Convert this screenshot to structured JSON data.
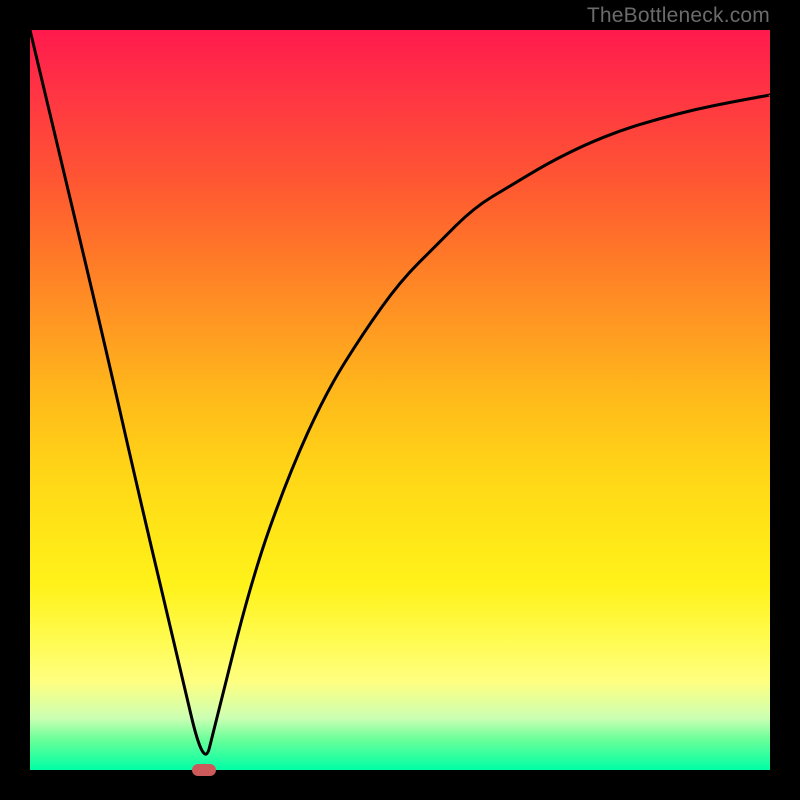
{
  "watermark": "TheBottleneck.com",
  "chart_data": {
    "type": "line",
    "title": "",
    "xlabel": "",
    "ylabel": "",
    "xlim": [
      0,
      100
    ],
    "ylim": [
      0,
      100
    ],
    "grid": false,
    "legend": false,
    "series": [
      {
        "name": "bottleneck-curve",
        "color": "#000000",
        "x": [
          0,
          5,
          10,
          15,
          20,
          23.5,
          25,
          30,
          35,
          40,
          45,
          50,
          55,
          60,
          65,
          70,
          75,
          80,
          85,
          90,
          95,
          100
        ],
        "values": [
          100,
          79,
          58,
          36,
          15,
          0,
          6,
          26,
          40,
          51,
          59,
          66,
          71,
          76,
          79,
          82,
          84.5,
          86.5,
          88,
          89.3,
          90.3,
          91.2
        ]
      }
    ],
    "annotations": [
      {
        "name": "minimum-marker",
        "x": 23.5,
        "y": 0,
        "color": "#cc5a5a"
      }
    ],
    "background_gradient": {
      "top": "#ff1a4d",
      "mid": "#ffee22",
      "bottom": "#00ffa6"
    }
  }
}
